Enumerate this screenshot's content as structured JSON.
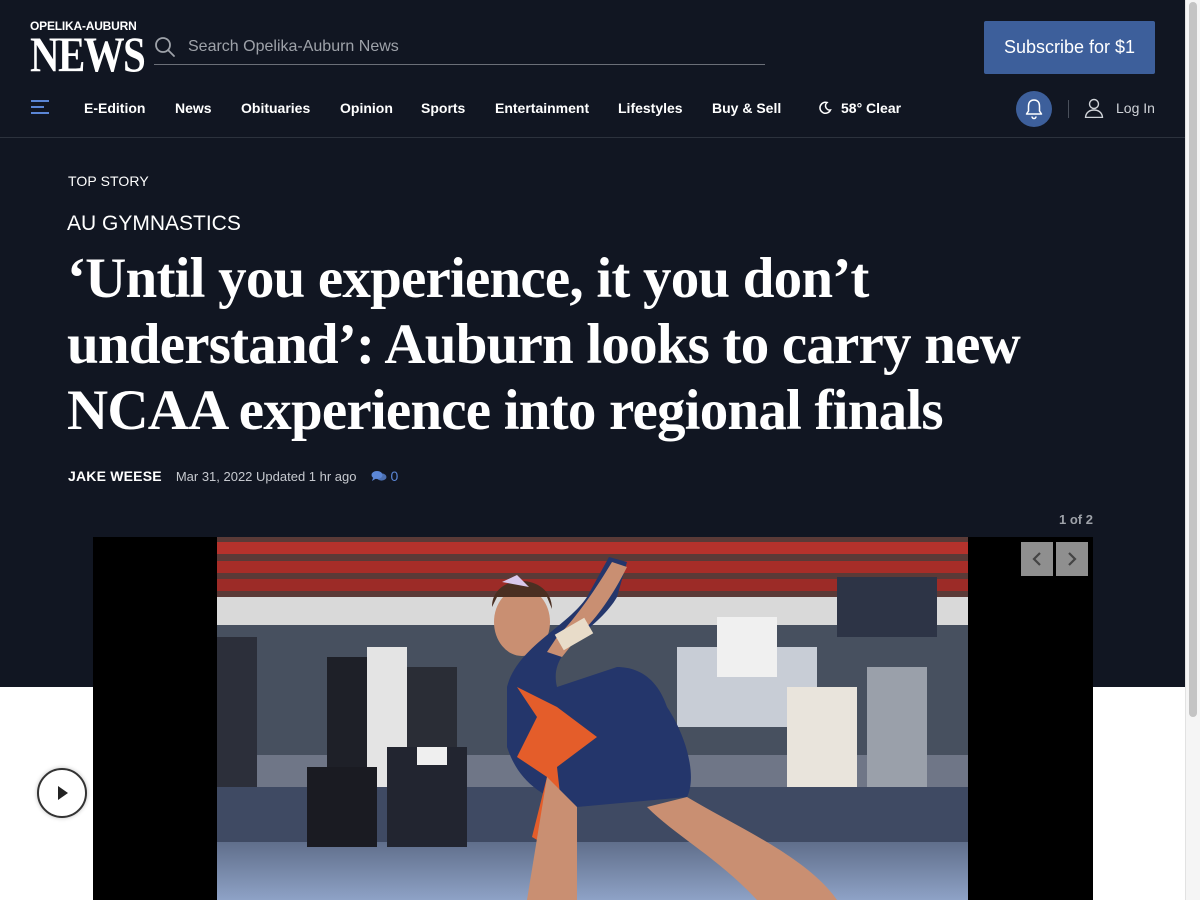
{
  "header": {
    "logo_small": "OPELIKA-AUBURN",
    "logo_big": "NEWS",
    "search_placeholder": "Search Opelika-Auburn News",
    "subscribe_label": "Subscribe for $1"
  },
  "nav": {
    "items": [
      "E-Edition",
      "News",
      "Obituaries",
      "Opinion",
      "Sports",
      "Entertainment",
      "Lifestyles",
      "Buy & Sell"
    ],
    "weather": "58° Clear",
    "login_label": "Log In"
  },
  "article": {
    "kicker": "TOP STORY",
    "section": "AU GYMNASTICS",
    "headline": "‘Until you experience, it you don’t understand’: Auburn looks to carry new NCAA experience into regional finals",
    "author": "JAKE WEESE",
    "date": "Mar 31, 2022 Updated 1 hr ago",
    "comment_count": "0"
  },
  "gallery": {
    "counter": "1 of 2"
  },
  "colors": {
    "page_background": "#111622",
    "accent": "#3d5f9b",
    "link": "#5b86d6"
  },
  "icons": [
    "search-icon",
    "menu-icon",
    "moon-icon",
    "bell-icon",
    "user-icon",
    "comment-icon",
    "chevron-left-icon",
    "chevron-right-icon",
    "play-icon"
  ]
}
